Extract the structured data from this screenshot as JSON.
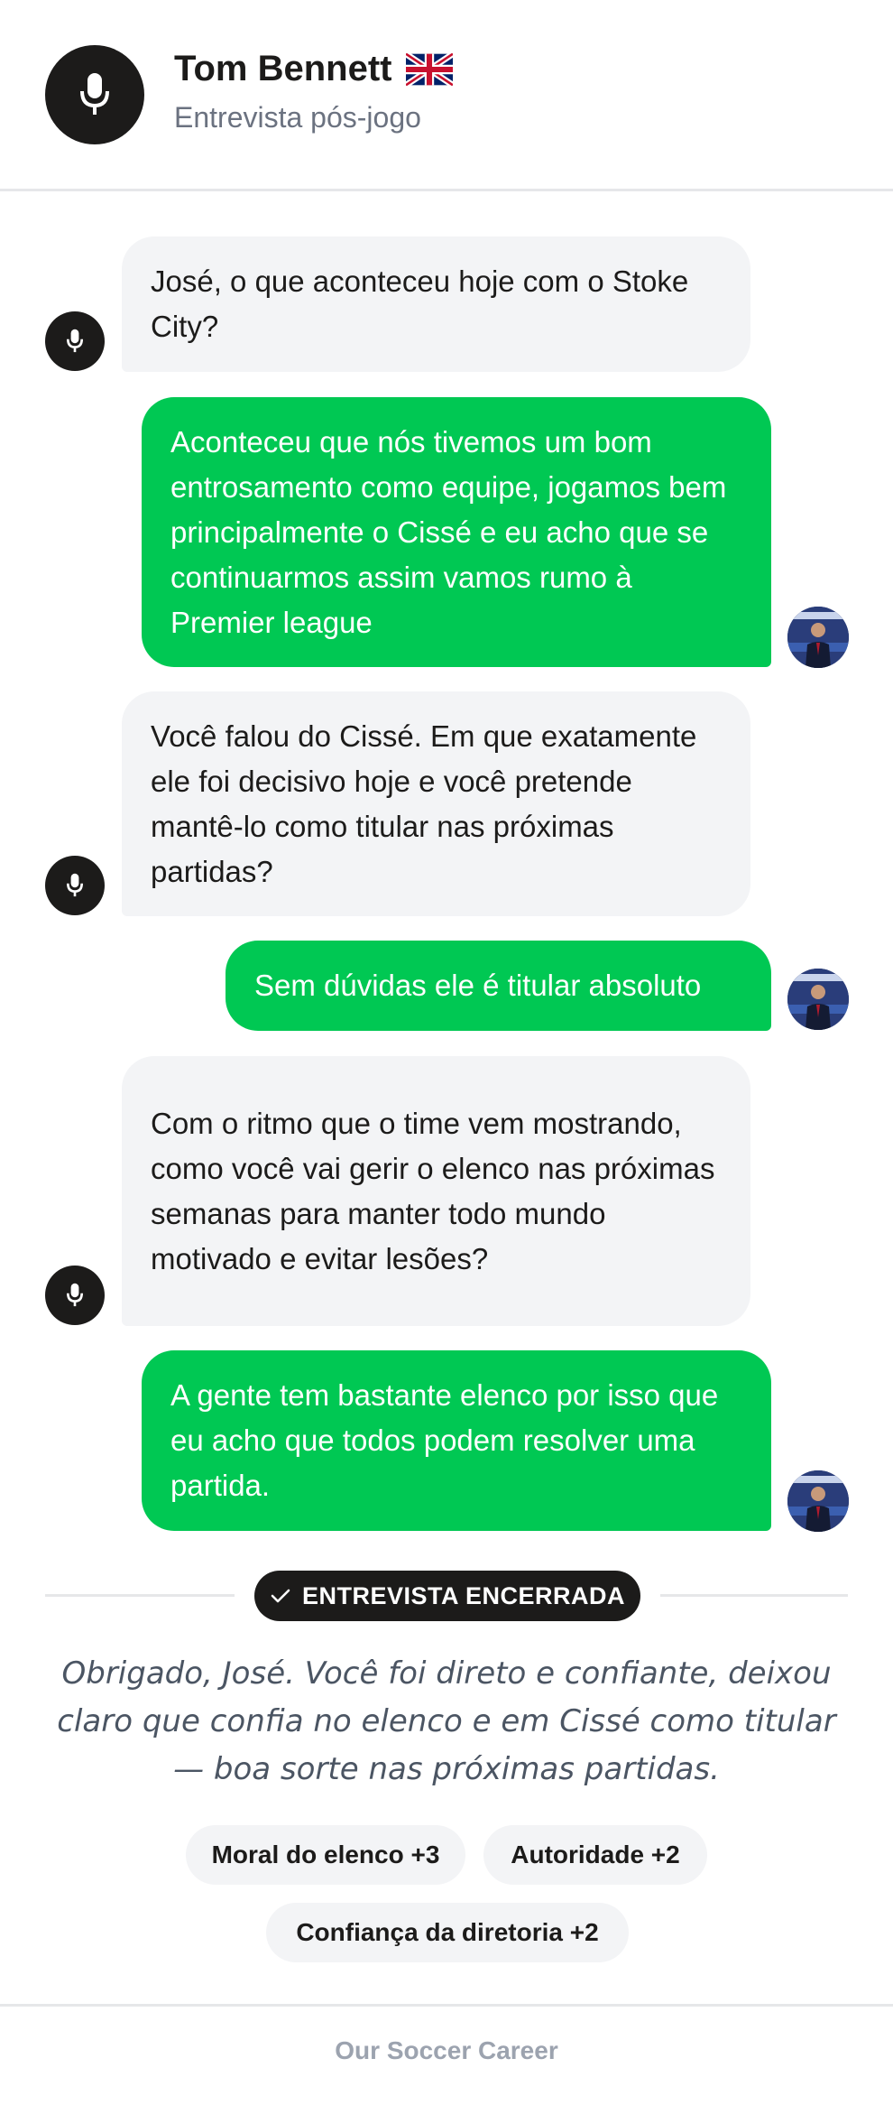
{
  "header": {
    "name": "Tom Bennett",
    "flag": "uk-flag",
    "subtitle": "Entrevista pós-jogo",
    "avatar_icon": "microphone-icon"
  },
  "messages": [
    {
      "from": "interviewer",
      "text": "José, o que aconteceu hoje com o Stoke City?"
    },
    {
      "from": "player",
      "text": "Aconteceu que nós tivemos um bom entrosamento como equipe, jogamos bem principalmente o Cissé e eu acho que se continuarmos assim vamos rumo à Premier league"
    },
    {
      "from": "interviewer",
      "text": "Você falou do Cissé. Em que exatamente ele foi decisivo hoje e você pretende mantê-lo como titular nas próximas partidas?"
    },
    {
      "from": "player",
      "text": "Sem dúvidas ele é titular absoluto"
    },
    {
      "from": "interviewer",
      "text": "Com o ritmo que o time vem mostrando, como você vai gerir o elenco nas próximas semanas para manter todo mundo motivado e evitar lesões?"
    },
    {
      "from": "player",
      "text": "A gente tem bastante elenco por isso que eu acho que todos podem resolver uma partida."
    }
  ],
  "status": {
    "label": "ENTREVISTA ENCERRADA",
    "icon": "check-icon"
  },
  "closing_text": "Obrigado, José. Você foi direto e confiante, deixou claro que confia no elenco e em Cissé como titular — boa sorte nas próximas partidas.",
  "effects": [
    "Moral do elenco +3",
    "Autoridade +2",
    "Confiança da diretoria +2"
  ],
  "footer": "Our Soccer Career",
  "colors": {
    "accent_green": "#00c853",
    "dark": "#1c1b1a",
    "bubble_gray": "#f3f4f6"
  }
}
